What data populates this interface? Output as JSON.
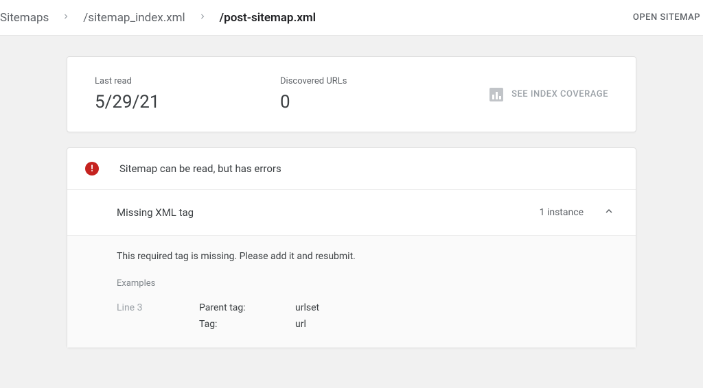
{
  "breadcrumbs": {
    "items": [
      "Sitemaps",
      "/sitemap_index.xml",
      "/post-sitemap.xml"
    ]
  },
  "open_sitemap": "OPEN SITEMAP",
  "summary": {
    "last_read_label": "Last read",
    "last_read_value": "5/29/21",
    "discovered_label": "Discovered URLs",
    "discovered_value": "0",
    "see_index_label": "SEE INDEX COVERAGE"
  },
  "errors": {
    "header": "Sitemap can be read, but has errors",
    "issue_name": "Missing XML tag",
    "issue_count": "1 instance",
    "detail_desc": "This required tag is missing. Please add it and resubmit.",
    "examples_label": "Examples",
    "example_line": "Line 3",
    "parent_tag_label": "Parent tag:",
    "parent_tag_value": "urlset",
    "tag_label": "Tag:",
    "tag_value": "url"
  }
}
